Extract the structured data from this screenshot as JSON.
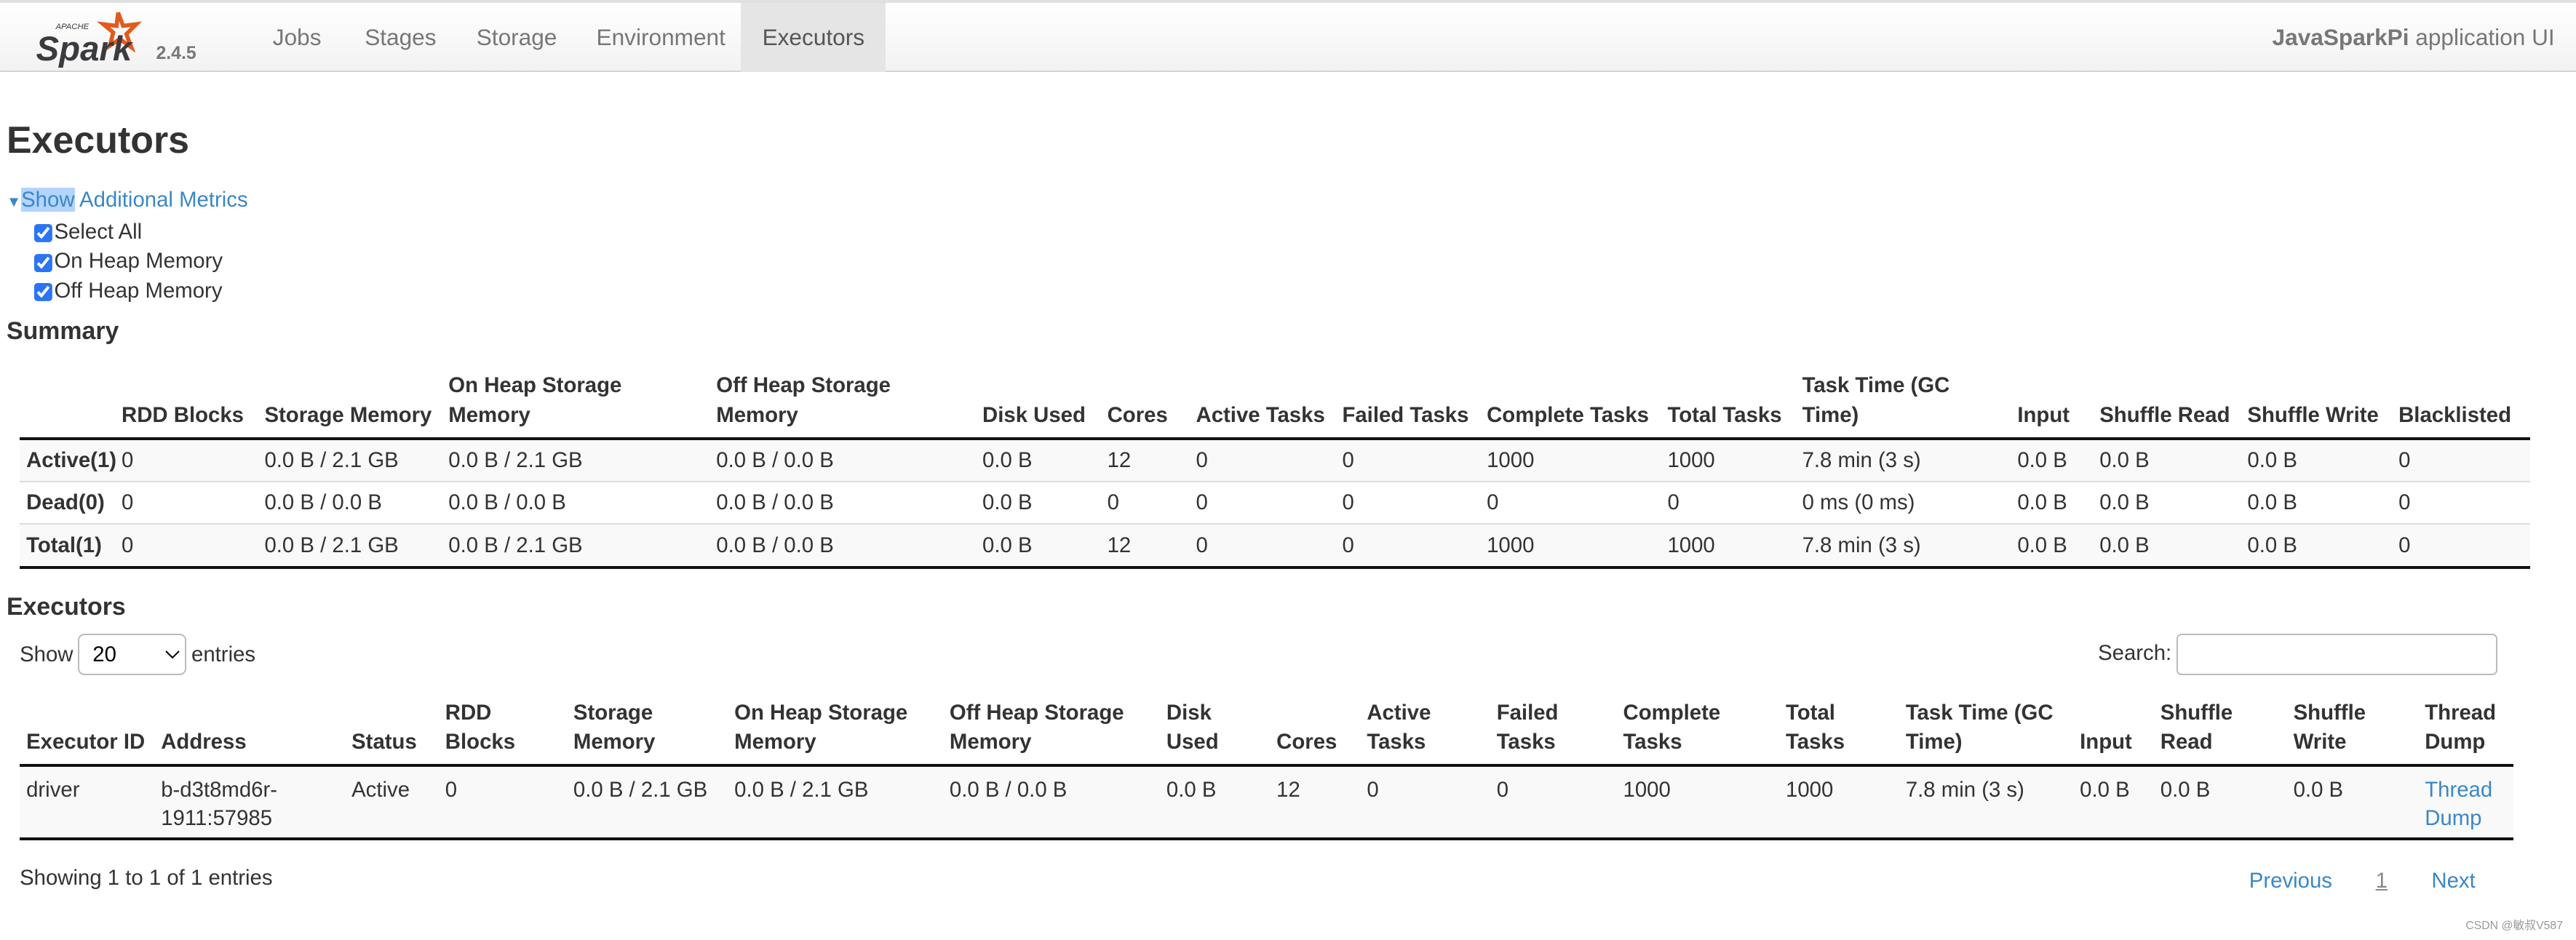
{
  "nav": {
    "version": "2.4.5",
    "items": [
      "Jobs",
      "Stages",
      "Storage",
      "Environment",
      "Executors"
    ],
    "active": "Executors",
    "app_name": "JavaSparkPi",
    "app_suffix": " application UI",
    "brand_color": "#e25a1c"
  },
  "page_title": "Executors",
  "metrics": {
    "toggle_highlight": "Show",
    "toggle_rest": " Additional Metrics",
    "options": [
      {
        "label": "Select All",
        "checked": true
      },
      {
        "label": "On Heap Memory",
        "checked": true
      },
      {
        "label": "Off Heap Memory",
        "checked": true
      }
    ]
  },
  "summary": {
    "title": "Summary",
    "headers": [
      "",
      "RDD Blocks",
      "Storage Memory",
      "On Heap Storage Memory",
      "Off Heap Storage Memory",
      "Disk Used",
      "Cores",
      "Active Tasks",
      "Failed Tasks",
      "Complete Tasks",
      "Total Tasks",
      "Task Time (GC Time)",
      "Input",
      "Shuffle Read",
      "Shuffle Write",
      "Blacklisted"
    ],
    "rows": [
      [
        "Active(1)",
        "0",
        "0.0 B / 2.1 GB",
        "0.0 B / 2.1 GB",
        "0.0 B / 0.0 B",
        "0.0 B",
        "12",
        "0",
        "0",
        "1000",
        "1000",
        "7.8 min (3 s)",
        "0.0 B",
        "0.0 B",
        "0.0 B",
        "0"
      ],
      [
        "Dead(0)",
        "0",
        "0.0 B / 0.0 B",
        "0.0 B / 0.0 B",
        "0.0 B / 0.0 B",
        "0.0 B",
        "0",
        "0",
        "0",
        "0",
        "0",
        "0 ms (0 ms)",
        "0.0 B",
        "0.0 B",
        "0.0 B",
        "0"
      ],
      [
        "Total(1)",
        "0",
        "0.0 B / 2.1 GB",
        "0.0 B / 2.1 GB",
        "0.0 B / 0.0 B",
        "0.0 B",
        "12",
        "0",
        "0",
        "1000",
        "1000",
        "7.8 min (3 s)",
        "0.0 B",
        "0.0 B",
        "0.0 B",
        "0"
      ]
    ]
  },
  "executors": {
    "title": "Executors",
    "show_label": "Show",
    "page_size": "20",
    "entries_label": "entries",
    "search_label": "Search:",
    "search_value": "",
    "headers": [
      "Executor ID",
      "Address",
      "Status",
      "RDD Blocks",
      "Storage Memory",
      "On Heap Storage Memory",
      "Off Heap Storage Memory",
      "Disk Used",
      "Cores",
      "Active Tasks",
      "Failed Tasks",
      "Complete Tasks",
      "Total Tasks",
      "Task Time (GC Time)",
      "Input",
      "Shuffle Read",
      "Shuffle Write",
      "Thread Dump"
    ],
    "rows": [
      [
        "driver",
        "b-d3t8md6r-1911:57985",
        "Active",
        "0",
        "0.0 B / 2.1 GB",
        "0.0 B / 2.1 GB",
        "0.0 B / 0.0 B",
        "0.0 B",
        "12",
        "0",
        "0",
        "1000",
        "1000",
        "7.8 min (3 s)",
        "0.0 B",
        "0.0 B",
        "0.0 B",
        "Thread Dump"
      ]
    ],
    "info": "Showing 1 to 1 of 1 entries",
    "previous": "Previous",
    "page": "1",
    "next": "Next"
  },
  "watermark": "CSDN @敏叔V587"
}
